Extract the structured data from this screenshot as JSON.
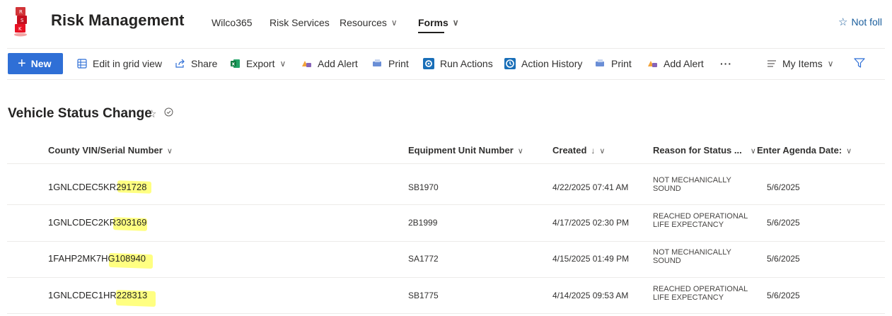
{
  "header": {
    "site_title": "Risk Management",
    "nav": [
      {
        "label": "Wilco365"
      },
      {
        "label": "Risk Services"
      },
      {
        "label": "Resources"
      },
      {
        "label": "Forms"
      }
    ],
    "follow_label": "Not foll"
  },
  "commands": {
    "new": "New",
    "edit_grid": "Edit in grid view",
    "share": "Share",
    "export": "Export",
    "add_alert": "Add Alert",
    "print": "Print",
    "run_actions": "Run Actions",
    "action_history": "Action History",
    "print2": "Print",
    "add_alert2": "Add Alert",
    "more": "···",
    "view": "My Items"
  },
  "list": {
    "title": "Vehicle Status Change",
    "columns": [
      "County VIN/Serial Number",
      "Equipment Unit Number",
      "Created",
      "Reason for Status ...",
      "Enter Agenda Date:"
    ],
    "rows": [
      {
        "vin": "1GNLCDEC5KR291728",
        "unit": "SB1970",
        "created": "4/22/2025 07:41 AM",
        "reason": "NOT MECHANICALLY SOUND",
        "agenda": "5/6/2025"
      },
      {
        "vin": "1GNLCDEC2KR303169",
        "unit": "2B1999",
        "created": "4/17/2025 02:30 PM",
        "reason": "REACHED OPERATIONAL LIFE EXPECTANCY",
        "agenda": "5/6/2025"
      },
      {
        "vin": "1FAHP2MK7HG108940",
        "unit": "SA1772",
        "created": "4/15/2025 01:49 PM",
        "reason": "NOT MECHANICALLY SOUND",
        "agenda": "5/6/2025"
      },
      {
        "vin": "1GNLCDEC1HR228313",
        "unit": "SB1775",
        "created": "4/14/2025 09:53 AM",
        "reason": "REACHED OPERATIONAL LIFE EXPECTANCY",
        "agenda": "5/6/2025"
      }
    ]
  },
  "colors": {
    "accent": "#2f6fd6",
    "highlight": "#ffff6b",
    "text": "#323130"
  }
}
